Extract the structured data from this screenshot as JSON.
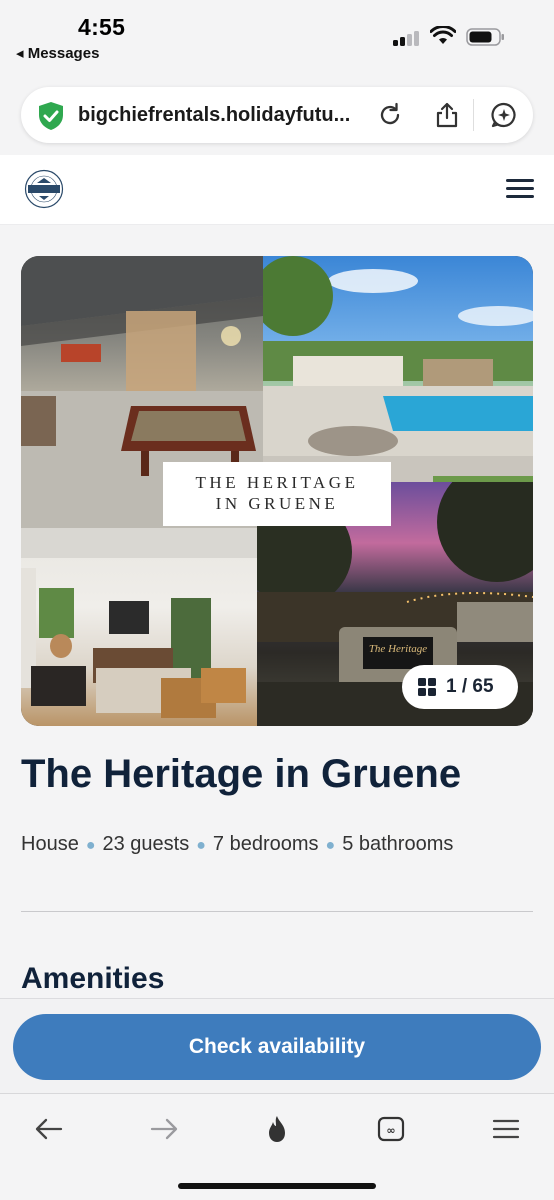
{
  "status_bar": {
    "time": "4:55",
    "back_app": "◂ Messages"
  },
  "browser": {
    "url": "bigchiefrentals.holidayfutu...",
    "icons": [
      "shield-check-icon",
      "reload-icon",
      "share-icon",
      "assistant-icon"
    ]
  },
  "site": {
    "logo_text": "BIG CHIEF",
    "logo_ring_text": "VACATION PROPERTIES"
  },
  "gallery": {
    "overlay_line1": "THE HERITAGE",
    "overlay_line2": "IN GRUENE",
    "sign_text": "The Heritage",
    "counter": "1 / 65"
  },
  "property": {
    "title": "The Heritage in Gruene",
    "features": [
      "House",
      "23 guests",
      "7 bedrooms",
      "5 bathrooms"
    ]
  },
  "amenities": {
    "title": "Amenities"
  },
  "cta": {
    "label": "Check availability",
    "color": "#3e7cbd"
  },
  "toolbar": {
    "items": [
      "back-arrow-icon",
      "forward-arrow-icon",
      "flame-icon",
      "tabs-icon",
      "menu-icon"
    ]
  }
}
